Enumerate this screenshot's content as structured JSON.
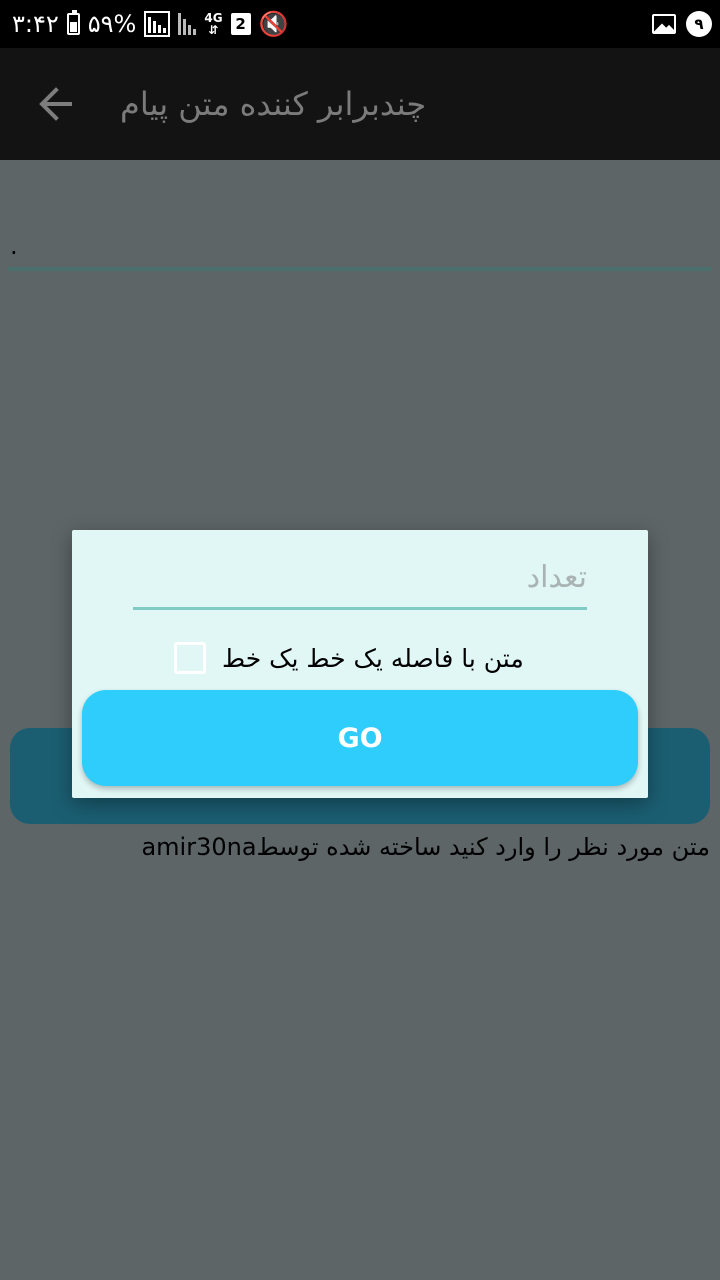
{
  "status_bar": {
    "time": "۳:۴۲",
    "battery_percent": "۵۹%",
    "battery_level": 0.59,
    "network_type": "4G",
    "sim_slot": "2",
    "notification_count": "۹"
  },
  "app_bar": {
    "title": "چندبرابر کننده متن پیام",
    "back_icon": "arrow-left-icon"
  },
  "background": {
    "input_value": ".",
    "caption": "متن مورد نظر را وارد کنید ساخته شده توسطamir30na",
    "button_color": "#1b5e72"
  },
  "dialog": {
    "count_placeholder": "تعداد",
    "count_value": "",
    "checkbox_label": "متن با فاصله یک خط یک خط",
    "checkbox_checked": false,
    "go_label": "GO",
    "go_color": "#2ecdfc",
    "accent_color": "#80cbc4"
  }
}
